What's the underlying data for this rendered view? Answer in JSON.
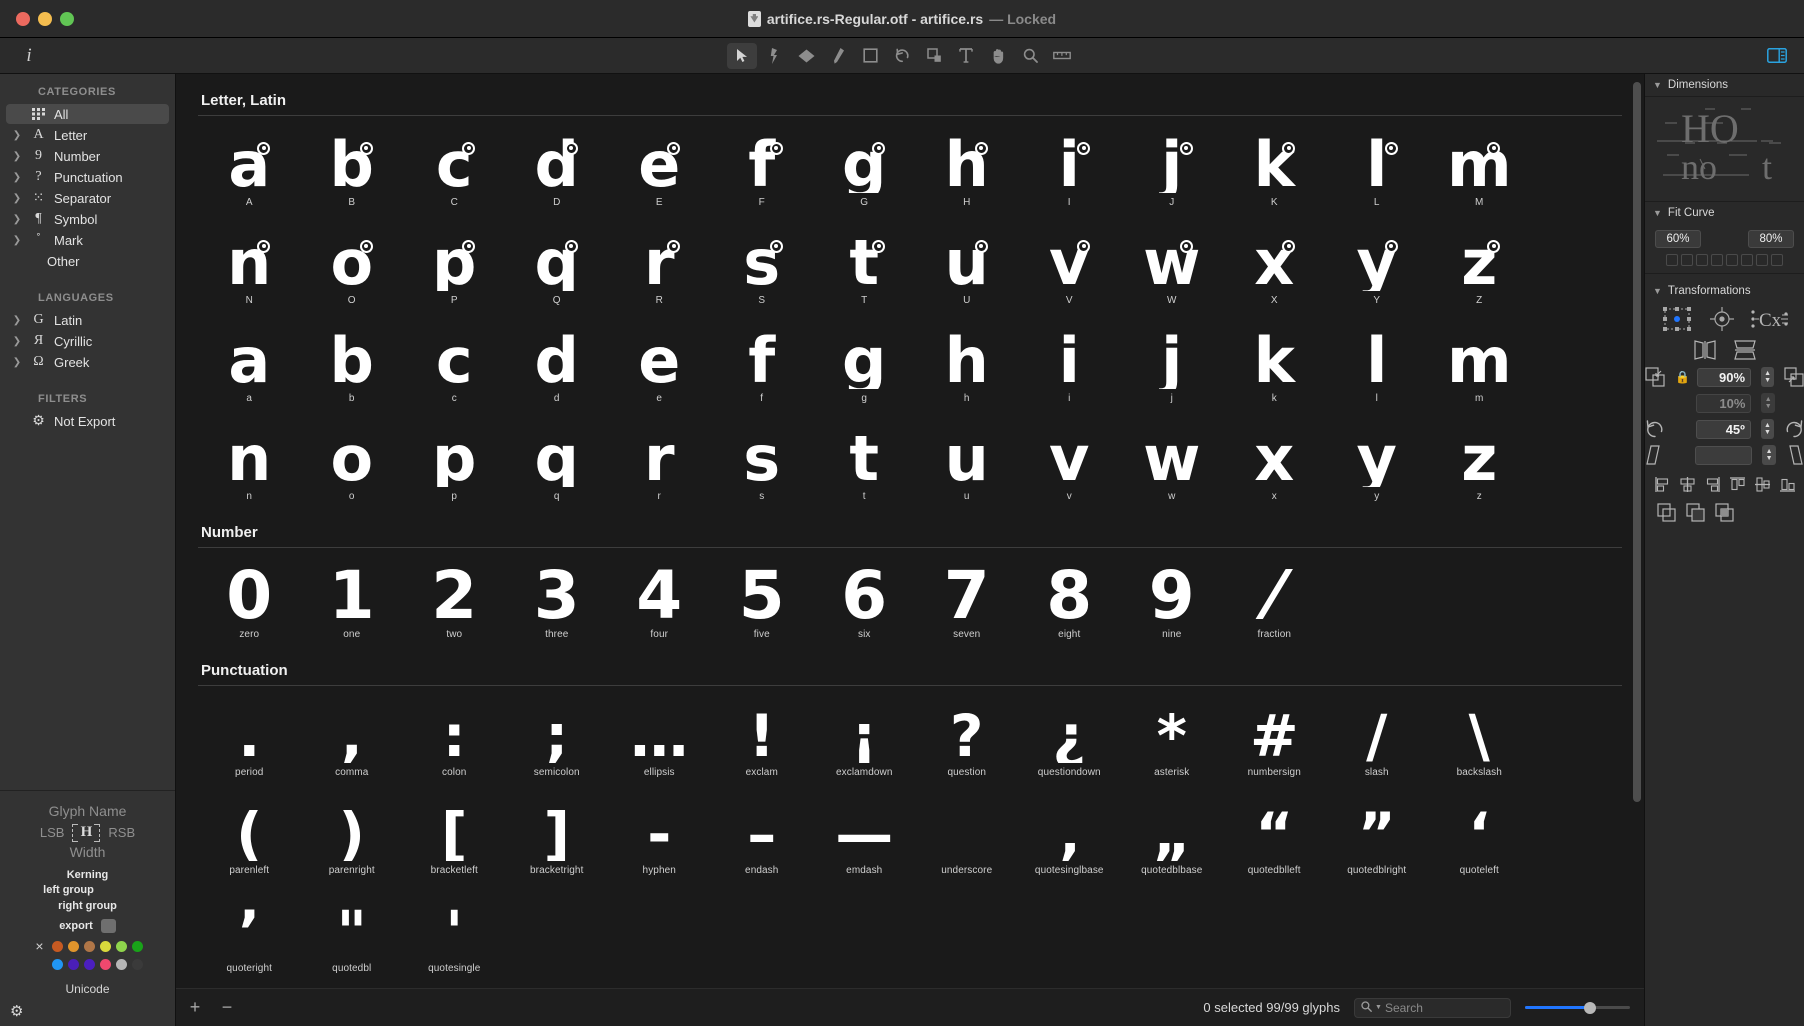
{
  "window": {
    "title": "artifice.rs-Regular.otf - artifice.rs",
    "title_suffix": "— Locked",
    "doc_icon": "document-icon"
  },
  "toolbar": {
    "info_label": "i",
    "tools": [
      {
        "name": "select-tool",
        "icon": "arrow-cursor-icon",
        "active": true
      },
      {
        "name": "pen-tool",
        "icon": "pen-nib-icon",
        "active": false
      },
      {
        "name": "eraser-tool",
        "icon": "eraser-icon",
        "active": false
      },
      {
        "name": "pencil-tool",
        "icon": "pencil-icon",
        "active": false
      },
      {
        "name": "shape-tool",
        "icon": "rectangle-icon",
        "active": false
      },
      {
        "name": "rotate-tool",
        "icon": "rotate-ccw-icon",
        "active": false
      },
      {
        "name": "scale-tool",
        "icon": "scale-icon",
        "active": false
      },
      {
        "name": "text-tool",
        "icon": "text-t-icon",
        "active": false
      },
      {
        "name": "hand-tool",
        "icon": "hand-icon",
        "active": false
      },
      {
        "name": "zoom-tool",
        "icon": "magnifier-icon",
        "active": false
      },
      {
        "name": "measure-tool",
        "icon": "ruler-icon",
        "active": false
      }
    ],
    "panel_toggle": "right-panel-toggle-icon",
    "accent_color": "#2aa3e0"
  },
  "sidebar": {
    "categories_header": "CATEGORIES",
    "categories": [
      {
        "label": "All",
        "icon": "grid-icon",
        "disclosure": false,
        "selected": true
      },
      {
        "label": "Letter",
        "icon": "letter-A-icon",
        "disclosure": true,
        "selected": false
      },
      {
        "label": "Number",
        "icon": "numeral-9-icon",
        "disclosure": true,
        "selected": false
      },
      {
        "label": "Punctuation",
        "icon": "question-mark-icon",
        "disclosure": true,
        "selected": false
      },
      {
        "label": "Separator",
        "icon": "dotted-separator-icon",
        "disclosure": true,
        "selected": false
      },
      {
        "label": "Symbol",
        "icon": "pilcrow-icon",
        "disclosure": true,
        "selected": false
      },
      {
        "label": "Mark",
        "icon": "accent-mark-icon",
        "disclosure": true,
        "selected": false
      },
      {
        "label": "Other",
        "icon": "",
        "disclosure": false,
        "selected": false
      }
    ],
    "languages_header": "LANGUAGES",
    "languages": [
      {
        "label": "Latin",
        "icon": "latin-G-icon",
        "disclosure": true
      },
      {
        "label": "Cyrillic",
        "icon": "cyrillic-YA-icon",
        "disclosure": true
      },
      {
        "label": "Greek",
        "icon": "greek-omega-icon",
        "disclosure": true
      }
    ],
    "filters_header": "FILTERS",
    "filters": [
      {
        "label": "Not Export",
        "icon": "gear-icon"
      }
    ],
    "inspector": {
      "glyph_name": "Glyph Name",
      "lsb": "LSB",
      "rsb": "RSB",
      "width": "Width",
      "kerning": "Kerning",
      "left_group": "left group",
      "right_group": "right group",
      "export": "export",
      "unicode": "Unicode",
      "gear": "gear-icon",
      "no_color": "×",
      "swatch_colors_row1": [
        "#c65a22",
        "#e0952c",
        "#b07647",
        "#d8d93c",
        "#8fd44c",
        "#19a319"
      ],
      "swatch_colors_row2": [
        "#2196f3",
        "#4a1fb8",
        "#4b1fc0",
        "#f0486e",
        "#b6b6b6",
        "#3a3a3a"
      ]
    }
  },
  "main": {
    "sections": [
      {
        "title": "Letter, Latin",
        "variant": "g-up",
        "glyphs": [
          {
            "art": "a",
            "name": "A",
            "marked": true
          },
          {
            "art": "b",
            "name": "B",
            "marked": true
          },
          {
            "art": "c",
            "name": "C",
            "marked": true
          },
          {
            "art": "d",
            "name": "D",
            "marked": true
          },
          {
            "art": "e",
            "name": "E",
            "marked": true
          },
          {
            "art": "f",
            "name": "F",
            "marked": true
          },
          {
            "art": "g",
            "name": "G",
            "marked": true
          },
          {
            "art": "h",
            "name": "H",
            "marked": true
          },
          {
            "art": "i",
            "name": "I",
            "marked": true
          },
          {
            "art": "j",
            "name": "J",
            "marked": true
          },
          {
            "art": "k",
            "name": "K",
            "marked": true
          },
          {
            "art": "l",
            "name": "L",
            "marked": true
          },
          {
            "art": "m",
            "name": "M",
            "marked": true
          },
          {
            "art": "n",
            "name": "N",
            "marked": true
          },
          {
            "art": "o",
            "name": "O",
            "marked": true
          },
          {
            "art": "p",
            "name": "P",
            "marked": true
          },
          {
            "art": "q",
            "name": "Q",
            "marked": true
          },
          {
            "art": "r",
            "name": "R",
            "marked": true
          },
          {
            "art": "s",
            "name": "S",
            "marked": true
          },
          {
            "art": "t",
            "name": "T",
            "marked": true
          },
          {
            "art": "u",
            "name": "U",
            "marked": true
          },
          {
            "art": "v",
            "name": "V",
            "marked": true
          },
          {
            "art": "w",
            "name": "W",
            "marked": true
          },
          {
            "art": "x",
            "name": "X",
            "marked": true
          },
          {
            "art": "y",
            "name": "Y",
            "marked": true
          },
          {
            "art": "z",
            "name": "Z",
            "marked": true
          },
          {
            "art": "a",
            "name": "a",
            "marked": false
          },
          {
            "art": "b",
            "name": "b",
            "marked": false
          },
          {
            "art": "c",
            "name": "c",
            "marked": false
          },
          {
            "art": "d",
            "name": "d",
            "marked": false
          },
          {
            "art": "e",
            "name": "e",
            "marked": false
          },
          {
            "art": "f",
            "name": "f",
            "marked": false
          },
          {
            "art": "g",
            "name": "g",
            "marked": false
          },
          {
            "art": "h",
            "name": "h",
            "marked": false
          },
          {
            "art": "i",
            "name": "i",
            "marked": false
          },
          {
            "art": "j",
            "name": "j",
            "marked": false
          },
          {
            "art": "k",
            "name": "k",
            "marked": false
          },
          {
            "art": "l",
            "name": "l",
            "marked": false
          },
          {
            "art": "m",
            "name": "m",
            "marked": false
          },
          {
            "art": "n",
            "name": "n",
            "marked": false
          },
          {
            "art": "o",
            "name": "o",
            "marked": false
          },
          {
            "art": "p",
            "name": "p",
            "marked": false
          },
          {
            "art": "q",
            "name": "q",
            "marked": false
          },
          {
            "art": "r",
            "name": "r",
            "marked": false
          },
          {
            "art": "s",
            "name": "s",
            "marked": false
          },
          {
            "art": "t",
            "name": "t",
            "marked": false
          },
          {
            "art": "u",
            "name": "u",
            "marked": false
          },
          {
            "art": "v",
            "name": "v",
            "marked": false
          },
          {
            "art": "w",
            "name": "w",
            "marked": false
          },
          {
            "art": "x",
            "name": "x",
            "marked": false
          },
          {
            "art": "y",
            "name": "y",
            "marked": false
          },
          {
            "art": "z",
            "name": "z",
            "marked": false
          }
        ]
      },
      {
        "title": "Number",
        "variant": "g-num",
        "glyphs": [
          {
            "art": "0",
            "name": "zero",
            "marked": false
          },
          {
            "art": "1",
            "name": "one",
            "marked": false
          },
          {
            "art": "2",
            "name": "two",
            "marked": false
          },
          {
            "art": "3",
            "name": "three",
            "marked": false
          },
          {
            "art": "4",
            "name": "four",
            "marked": false
          },
          {
            "art": "5",
            "name": "five",
            "marked": false
          },
          {
            "art": "6",
            "name": "six",
            "marked": false
          },
          {
            "art": "7",
            "name": "seven",
            "marked": false
          },
          {
            "art": "8",
            "name": "eight",
            "marked": false
          },
          {
            "art": "9",
            "name": "nine",
            "marked": false
          },
          {
            "art": "⁄",
            "name": "fraction",
            "marked": false
          }
        ]
      },
      {
        "title": "Punctuation",
        "variant": "g-pun",
        "glyphs": [
          {
            "art": ".",
            "name": "period",
            "marked": false
          },
          {
            "art": ",",
            "name": "comma",
            "marked": false
          },
          {
            "art": ":",
            "name": "colon",
            "marked": false
          },
          {
            "art": ";",
            "name": "semicolon",
            "marked": false
          },
          {
            "art": "…",
            "name": "ellipsis",
            "marked": false
          },
          {
            "art": "!",
            "name": "exclam",
            "marked": false
          },
          {
            "art": "¡",
            "name": "exclamdown",
            "marked": false
          },
          {
            "art": "?",
            "name": "question",
            "marked": false
          },
          {
            "art": "¿",
            "name": "questiondown",
            "marked": false
          },
          {
            "art": "*",
            "name": "asterisk",
            "marked": false
          },
          {
            "art": "#",
            "name": "numbersign",
            "marked": false
          },
          {
            "art": "/",
            "name": "slash",
            "marked": false
          },
          {
            "art": "\\",
            "name": "backslash",
            "marked": false
          },
          {
            "art": "(",
            "name": "parenleft",
            "marked": false
          },
          {
            "art": ")",
            "name": "parenright",
            "marked": false
          },
          {
            "art": "[",
            "name": "bracketleft",
            "marked": false
          },
          {
            "art": "]",
            "name": "bracketright",
            "marked": false
          },
          {
            "art": "-",
            "name": "hyphen",
            "marked": false
          },
          {
            "art": "–",
            "name": "endash",
            "marked": false
          },
          {
            "art": "—",
            "name": "emdash",
            "marked": false
          },
          {
            "art": "_",
            "name": "underscore",
            "marked": false
          },
          {
            "art": "‚",
            "name": "quotesinglbase",
            "marked": false
          },
          {
            "art": "„",
            "name": "quotedblbase",
            "marked": false
          },
          {
            "art": "“",
            "name": "quotedblleft",
            "marked": false
          },
          {
            "art": "”",
            "name": "quotedblright",
            "marked": false
          },
          {
            "art": "‘",
            "name": "quoteleft",
            "marked": false
          },
          {
            "art": "’",
            "name": "quoteright",
            "marked": false
          },
          {
            "art": "\"",
            "name": "quotedbl",
            "marked": false
          },
          {
            "art": "'",
            "name": "quotesingle",
            "marked": false
          }
        ]
      }
    ]
  },
  "statusbar": {
    "add_label": "+",
    "remove_label": "−",
    "selection": "0 selected 99/99 glyphs",
    "search_placeholder": "Search",
    "search_value": "",
    "search_icon": "magnifier-icon",
    "zoom_fill_percent": 62,
    "slider_accent": "#2176ff"
  },
  "rightpanel": {
    "dimensions": {
      "title": "Dimensions",
      "sample_upper": "HO",
      "sample_lower": "no",
      "sample_t": "t"
    },
    "fitcurve": {
      "title": "Fit Curve",
      "left_value": "60%",
      "right_value": "80%",
      "dot_count": 8
    },
    "transformations": {
      "title": "Transformations",
      "origin_icon": "transform-origin-icon",
      "align_target_icon": "align-target-icon",
      "cx_icon": "cx-metrics-icon",
      "flip_h_icon": "flip-horizontal-icon",
      "flip_v_icon": "flip-vertical-icon",
      "scale_down_icon": "scale-down-icon",
      "scale_up_icon": "scale-up-icon",
      "lock_icon": "lock-icon",
      "scale_x": "90%",
      "scale_y": "10%",
      "rotate_ccw_icon": "rotate-ccw-icon",
      "rotate_cw_icon": "rotate-cw-icon",
      "rotate_value": "45º",
      "slant_left_icon": "slant-left-icon",
      "slant_right_icon": "slant-right-icon",
      "slant_value": "",
      "align_icons": [
        "align-left-icon",
        "align-center-h-icon",
        "align-right-icon",
        "align-top-icon",
        "align-middle-v-icon",
        "align-bottom-icon"
      ],
      "bool_icons": [
        "union-icon",
        "subtract-icon",
        "intersect-icon"
      ]
    }
  }
}
